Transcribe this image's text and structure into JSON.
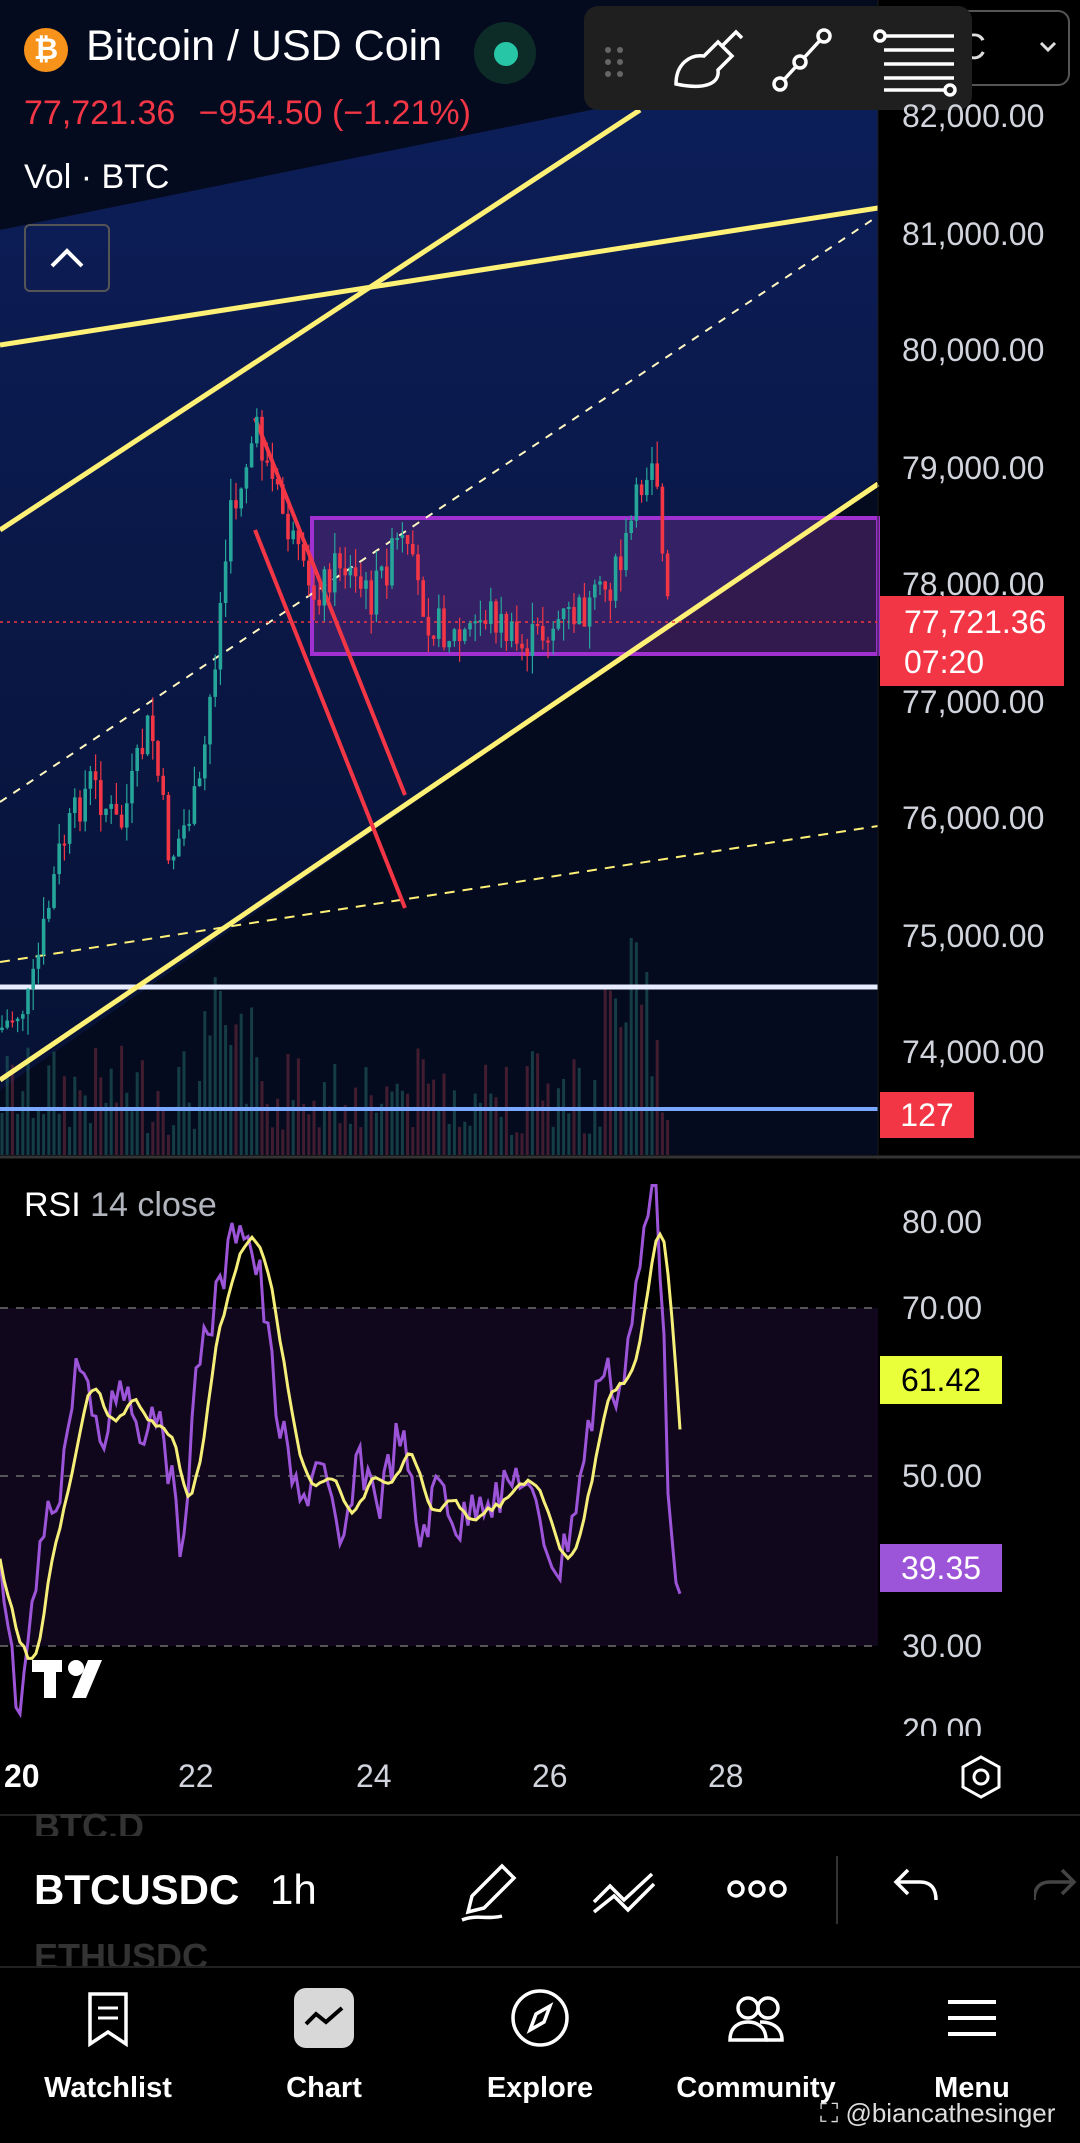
{
  "header": {
    "coin_symbol": "₿",
    "title": "Bitcoin / USD Coin",
    "last_price": "77,721.36",
    "change": "−954.50 (−1.21%)",
    "volume_label": "Vol · BTC",
    "symbol_box": "C"
  },
  "price_axis": {
    "labels": [
      "82,000.00",
      "81,000.00",
      "80,000.00",
      "79,000.00",
      "78,000.00",
      "77,000.00",
      "76,000.00",
      "75,000.00",
      "74,000.00"
    ],
    "current_price": "77,721.36",
    "countdown": "07:20",
    "volume_value": "127"
  },
  "rsi": {
    "title": "RSI",
    "params": "14 close",
    "axis_labels": [
      "80.00",
      "70.00",
      "50.00",
      "30.00",
      "20.00"
    ],
    "ma_value": "61.42",
    "rsi_value": "39.35"
  },
  "time_axis": {
    "labels": [
      "20",
      "22",
      "24",
      "26",
      "28"
    ]
  },
  "bottom_toolbar": {
    "symbol": "BTCUSDC",
    "symbol_above": "BTC.D",
    "symbol_below": "ETHUSDC",
    "interval": "1h"
  },
  "nav": {
    "items": [
      {
        "label": "Watchlist",
        "icon": "watchlist-icon"
      },
      {
        "label": "Chart",
        "icon": "chart-icon"
      },
      {
        "label": "Explore",
        "icon": "explore-icon"
      },
      {
        "label": "Community",
        "icon": "community-icon"
      },
      {
        "label": "Menu",
        "icon": "menu-icon"
      }
    ]
  },
  "watermark": "@biancathesinger",
  "colors": {
    "bull": "#26a69a",
    "bear": "#f23645",
    "channel": "#fff176",
    "rect": "#9c27b0",
    "rsi": "#9c55d8",
    "rsi_ma": "#f5ef7a",
    "bg_panel": "#0d1b47"
  }
}
